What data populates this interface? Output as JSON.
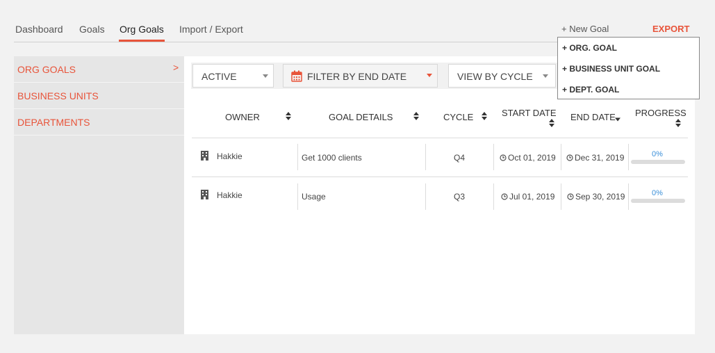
{
  "nav": {
    "tabs": [
      {
        "label": "Dashboard"
      },
      {
        "label": "Goals"
      },
      {
        "label": "Org Goals"
      },
      {
        "label": "Import / Export"
      }
    ],
    "new_goal_label": "+ New Goal",
    "export_label": "EXPORT"
  },
  "dropdown": {
    "items": [
      {
        "label": "+ ORG. GOAL"
      },
      {
        "label": "+ BUSINESS UNIT GOAL"
      },
      {
        "label": "+ DEPT. GOAL"
      }
    ]
  },
  "sidebar": {
    "items": [
      {
        "label": "ORG GOALS",
        "chevron": ">"
      },
      {
        "label": "BUSINESS UNITS"
      },
      {
        "label": "DEPARTMENTS"
      }
    ]
  },
  "filters": {
    "status": "ACTIVE",
    "date_filter": "FILTER BY END DATE",
    "view": "VIEW BY CYCLE"
  },
  "table": {
    "headers": {
      "owner": "OWNER",
      "goal_details": "GOAL DETAILS",
      "cycle": "CYCLE",
      "start_date": "START DATE",
      "end_date": "END DATE",
      "progress": "PROGRESS"
    },
    "rows": [
      {
        "owner": "Hakkie",
        "goal": "Get 1000 clients",
        "cycle": "Q4",
        "start": "Oct 01, 2019",
        "end": "Dec 31, 2019",
        "progress": "0%"
      },
      {
        "owner": "Hakkie",
        "goal": "Usage",
        "cycle": "Q3",
        "start": "Jul 01, 2019",
        "end": "Sep 30, 2019",
        "progress": "0%"
      }
    ]
  },
  "colors": {
    "accent": "#e8543a",
    "link_blue": "#3a8fd9",
    "sidebar_bg": "#e6e6e6",
    "page_bg": "#f2f2f2"
  }
}
